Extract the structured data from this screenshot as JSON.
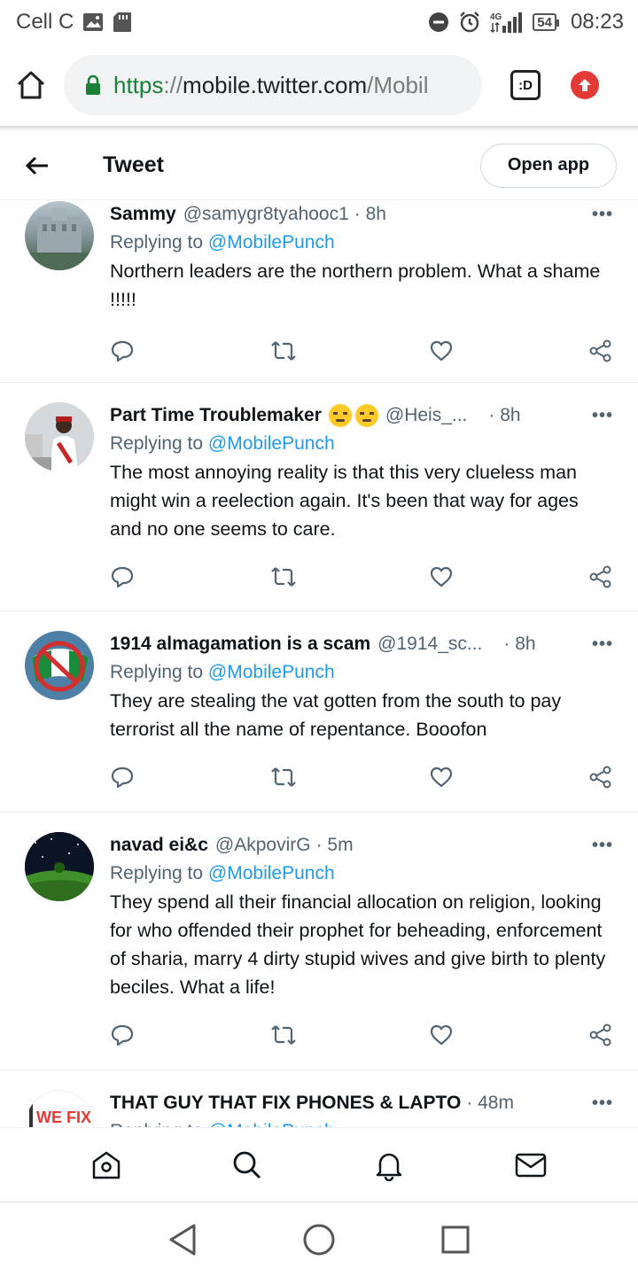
{
  "status_bar": {
    "carrier": "Cell C",
    "network": "4G",
    "battery": "54",
    "time": "08:23"
  },
  "browser": {
    "url_scheme": "https",
    "url_sep": "://",
    "url_host": "mobile.twitter.com",
    "url_path": "/Mobil",
    "tab_badge": ":D"
  },
  "header": {
    "title": "Tweet",
    "open_app": "Open app"
  },
  "replying_label": "Replying to",
  "replies": [
    {
      "name": "Sammy",
      "handle": "@samygr8tyahooc1",
      "time": "· 8h",
      "mention": "@MobilePunch",
      "text": "Northern leaders are the northern problem. What a shame !!!!!"
    },
    {
      "name": "Part Time Troublemaker",
      "handle": "@Heis_...",
      "time": "· 8h",
      "mention": "@MobilePunch",
      "text": "The most annoying reality is that this very clueless man might win a reelection again. It's been that way for ages and no one seems to care."
    },
    {
      "name": "1914 almagamation is a scam",
      "handle": "@1914_sc...",
      "time": "· 8h",
      "mention": "@MobilePunch",
      "text": "They are stealing the vat gotten from the south to pay terrorist all the name of repentance. Booofon"
    },
    {
      "name": "navad ei&c",
      "handle": "@AkpovirG",
      "time": "· 5m",
      "mention": "@MobilePunch",
      "text": "They spend all their financial allocation on religion, looking for who offended their prophet for beheading, enforcement of sharia, marry 4 dirty stupid wives and give birth to plenty beciles. What a life!"
    },
    {
      "name": "THAT GUY THAT FIX PHONES & LAPTO",
      "time": "· 48m",
      "avatar_text": "WE FIX"
    }
  ],
  "more_label": "•••",
  "colors": {
    "link": "#1d9bf0",
    "text": "#0f1419",
    "secondary": "#536471",
    "secure": "#188038"
  },
  "icons": {
    "reply": "reply-icon",
    "retweet": "retweet-icon",
    "like": "heart-icon",
    "share": "share-icon"
  }
}
